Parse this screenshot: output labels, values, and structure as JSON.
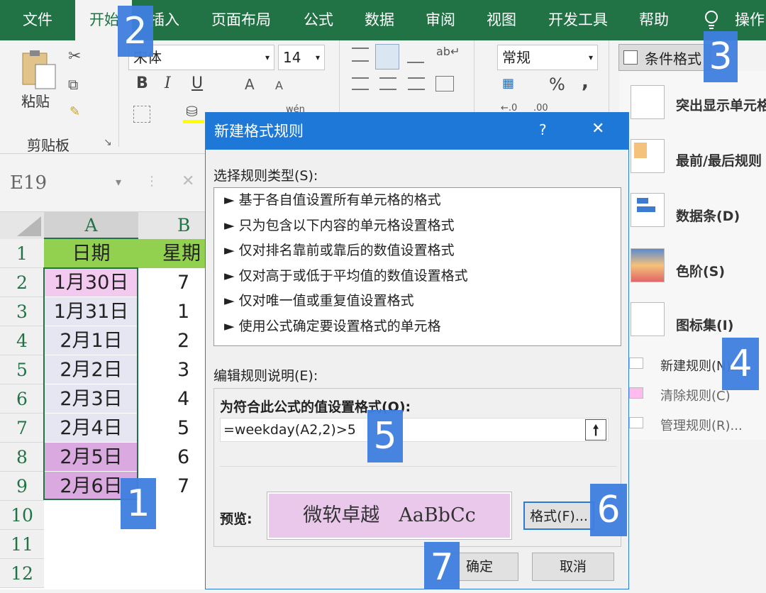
{
  "tabs": [
    "文件",
    "开始",
    "插入",
    "页面布局",
    "公式",
    "数据",
    "审阅",
    "视图",
    "开发工具",
    "帮助",
    "操作"
  ],
  "ribbon": {
    "paste": "粘贴",
    "clipboard": "剪贴板",
    "font_name": "宋体",
    "font_size": "14",
    "bold": "B",
    "italic": "I",
    "underline": "U",
    "number_format": "常规",
    "percent": "%",
    "comma": ",",
    "wen": "wén",
    "cond_format": "条件格式"
  },
  "namebox": "E19",
  "columns": [
    "A",
    "B"
  ],
  "rows": [
    "1",
    "2",
    "3",
    "4",
    "5",
    "6",
    "7",
    "8",
    "9",
    "10",
    "11",
    "12"
  ],
  "cells_a": [
    "日期",
    "1月30日",
    "1月31日",
    "2月1日",
    "2月2日",
    "2月3日",
    "2月4日",
    "2月5日",
    "2月6日"
  ],
  "cells_b": [
    "星期",
    "7",
    "1",
    "2",
    "3",
    "4",
    "5",
    "6",
    "7"
  ],
  "dialog": {
    "title": "新建格式规则",
    "help": "?",
    "close": "✕",
    "rule_type_label": "选择规则类型(S):",
    "rule_types": [
      "► 基于各自值设置所有单元格的格式",
      "► 只为包含以下内容的单元格设置格式",
      "► 仅对排名靠前或靠后的数值设置格式",
      "► 仅对高于或低于平均值的数值设置格式",
      "► 仅对唯一值或重复值设置格式",
      "► 使用公式确定要设置格式的单元格"
    ],
    "edit_label": "编辑规则说明(E):",
    "formula_label": "为符合此公式的值设置格式(O):",
    "formula": "=weekday(A2,2)>5",
    "preview_label": "预览:",
    "preview_text": "微软卓越　AaBbCc",
    "format_button": "格式(F)...",
    "ok": "确定",
    "cancel": "取消"
  },
  "cf_menu": [
    "突出显示单元格",
    "最前/最后规则",
    "数据条(D)",
    "色阶(S)",
    "图标集(I)"
  ],
  "cf_sub": [
    "新建规则(N)...",
    "清除规则(C)",
    "管理规则(R)..."
  ],
  "badges": [
    "1",
    "2",
    "3",
    "4",
    "5",
    "6",
    "7"
  ],
  "colors": {
    "excel_green": "#217346",
    "title_blue": "#1e78d7",
    "preview_pink": "#eac8ec",
    "badge_blue": "#3f7fe0"
  }
}
